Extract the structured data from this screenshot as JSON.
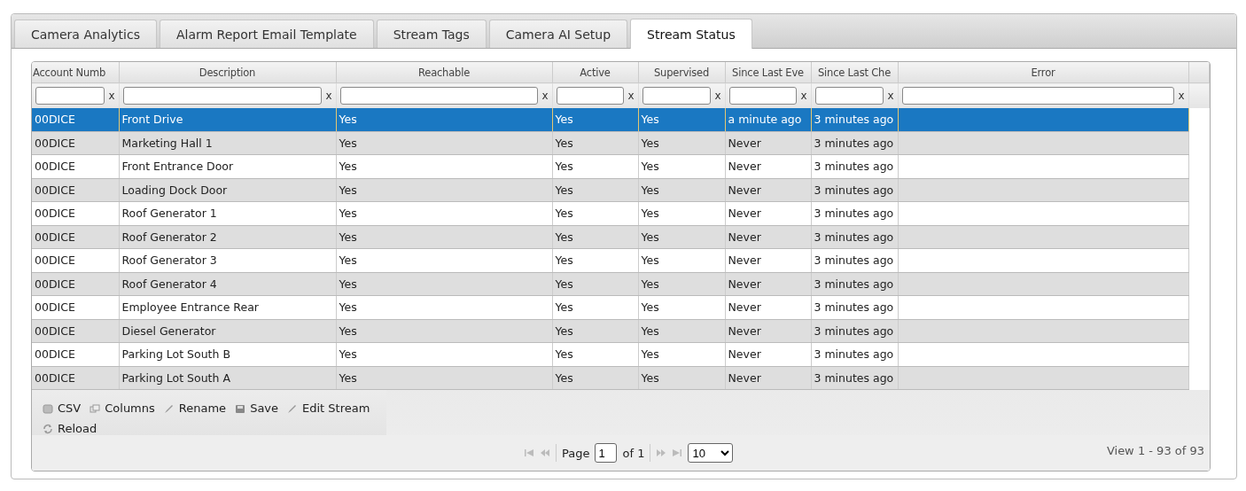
{
  "tabs": [
    {
      "label": "Camera Analytics",
      "selected": false
    },
    {
      "label": "Alarm Report Email Template",
      "selected": false
    },
    {
      "label": "Stream Tags",
      "selected": false
    },
    {
      "label": "Camera AI Setup",
      "selected": false
    },
    {
      "label": "Stream Status",
      "selected": true
    }
  ],
  "table": {
    "columns": [
      {
        "label": "Account Numb",
        "filter_clear": "x"
      },
      {
        "label": "Description",
        "filter_clear": "x"
      },
      {
        "label": "Reachable",
        "filter_clear": "x"
      },
      {
        "label": "Active",
        "filter_clear": "x"
      },
      {
        "label": "Supervised",
        "filter_clear": "x"
      },
      {
        "label": "Since Last Eve",
        "filter_clear": "x"
      },
      {
        "label": "Since Last Che",
        "filter_clear": "x"
      },
      {
        "label": "Error",
        "filter_clear": "x"
      }
    ],
    "rows": [
      {
        "selected": true,
        "cells": [
          "00DICE",
          "Front Drive",
          "Yes",
          "Yes",
          "Yes",
          "a minute ago",
          "3 minutes ago"
        ]
      },
      {
        "selected": false,
        "cells": [
          "00DICE",
          "Marketing Hall 1",
          "Yes",
          "Yes",
          "Yes",
          "Never",
          "3 minutes ago"
        ]
      },
      {
        "selected": false,
        "cells": [
          "00DICE",
          "Front Entrance Door",
          "Yes",
          "Yes",
          "Yes",
          "Never",
          "3 minutes ago"
        ]
      },
      {
        "selected": false,
        "cells": [
          "00DICE",
          "Loading Dock Door",
          "Yes",
          "Yes",
          "Yes",
          "Never",
          "3 minutes ago"
        ]
      },
      {
        "selected": false,
        "cells": [
          "00DICE",
          "Roof Generator 1",
          "Yes",
          "Yes",
          "Yes",
          "Never",
          "3 minutes ago"
        ]
      },
      {
        "selected": false,
        "cells": [
          "00DICE",
          "Roof Generator 2",
          "Yes",
          "Yes",
          "Yes",
          "Never",
          "3 minutes ago"
        ]
      },
      {
        "selected": false,
        "cells": [
          "00DICE",
          "Roof Generator 3",
          "Yes",
          "Yes",
          "Yes",
          "Never",
          "3 minutes ago"
        ]
      },
      {
        "selected": false,
        "cells": [
          "00DICE",
          "Roof Generator 4",
          "Yes",
          "Yes",
          "Yes",
          "Never",
          "3 minutes ago"
        ]
      },
      {
        "selected": false,
        "cells": [
          "00DICE",
          "Employee Entrance Rear",
          "Yes",
          "Yes",
          "Yes",
          "Never",
          "3 minutes ago"
        ]
      },
      {
        "selected": false,
        "cells": [
          "00DICE",
          "Diesel Generator",
          "Yes",
          "Yes",
          "Yes",
          "Never",
          "3 minutes ago"
        ]
      },
      {
        "selected": false,
        "cells": [
          "00DICE",
          "Parking Lot South B",
          "Yes",
          "Yes",
          "Yes",
          "Never",
          "3 minutes ago"
        ]
      },
      {
        "selected": false,
        "cells": [
          "00DICE",
          "Parking Lot South A",
          "Yes",
          "Yes",
          "Yes",
          "Never",
          "3 minutes ago"
        ]
      }
    ]
  },
  "toolbar": [
    {
      "kind": "csv",
      "label": "CSV"
    },
    {
      "kind": "columns",
      "label": "Columns"
    },
    {
      "kind": "pencil",
      "label": "Rename"
    },
    {
      "kind": "disk",
      "label": "Save"
    },
    {
      "kind": "pencil",
      "label": "Edit Stream"
    },
    {
      "kind": "reload",
      "label": "Reload"
    }
  ],
  "pager": {
    "page_label": "Page",
    "page": "1",
    "of_label": "of 1",
    "page_size": "10",
    "summary": "View 1 - 93 of 93"
  }
}
